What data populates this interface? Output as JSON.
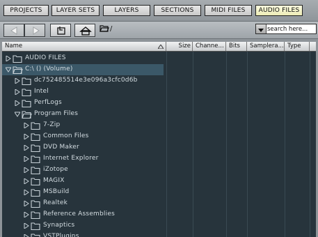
{
  "tabs": [
    {
      "label": "PROJECTS",
      "active": false
    },
    {
      "label": "LAYER SETS",
      "active": false
    },
    {
      "label": "LAYERS",
      "active": false
    },
    {
      "label": "SECTIONS",
      "active": false
    },
    {
      "label": "MIDI FILES",
      "active": false
    },
    {
      "label": "AUDIO FILES",
      "active": true
    }
  ],
  "nav": {
    "back_icon": "back-arrow-icon",
    "forward_icon": "forward-arrow-icon",
    "up_icon": "folder-up-icon",
    "home_icon": "home-icon",
    "path": "/"
  },
  "search": {
    "placeholder": "search here..."
  },
  "columns": [
    {
      "label": "Name",
      "sorted": true
    },
    {
      "label": "Size"
    },
    {
      "label": "Channe..."
    },
    {
      "label": "Bits"
    },
    {
      "label": "Samplera..."
    },
    {
      "label": "Type"
    }
  ],
  "tree": [
    {
      "name": "AUDIO FILES",
      "depth": 0,
      "expanded": false,
      "open_folder": false
    },
    {
      "name": "C:\\ () (Volume)",
      "depth": 0,
      "expanded": true,
      "open_folder": true
    },
    {
      "name": "dc752485514e3e096a3cfc0d6b",
      "depth": 1,
      "expanded": false,
      "open_folder": false
    },
    {
      "name": "Intel",
      "depth": 1,
      "expanded": false,
      "open_folder": false
    },
    {
      "name": "PerfLogs",
      "depth": 1,
      "expanded": false,
      "open_folder": false
    },
    {
      "name": "Program Files",
      "depth": 1,
      "expanded": true,
      "open_folder": true
    },
    {
      "name": "7-Zip",
      "depth": 2,
      "expanded": false,
      "open_folder": false
    },
    {
      "name": "Common Files",
      "depth": 2,
      "expanded": false,
      "open_folder": false
    },
    {
      "name": "DVD Maker",
      "depth": 2,
      "expanded": false,
      "open_folder": false
    },
    {
      "name": "Internet Explorer",
      "depth": 2,
      "expanded": false,
      "open_folder": false
    },
    {
      "name": "iZotope",
      "depth": 2,
      "expanded": false,
      "open_folder": false
    },
    {
      "name": "MAGIX",
      "depth": 2,
      "expanded": false,
      "open_folder": false
    },
    {
      "name": "MSBuild",
      "depth": 2,
      "expanded": false,
      "open_folder": false
    },
    {
      "name": "Realtek",
      "depth": 2,
      "expanded": false,
      "open_folder": false
    },
    {
      "name": "Reference Assemblies",
      "depth": 2,
      "expanded": false,
      "open_folder": false
    },
    {
      "name": "Synaptics",
      "depth": 2,
      "expanded": false,
      "open_folder": false
    },
    {
      "name": "VSTPlugins",
      "depth": 2,
      "expanded": false,
      "open_folder": false
    }
  ],
  "colors": {
    "active_tab": "#f4f3c8",
    "grid_background": "#27343c",
    "selected_row": "#3b5868",
    "tree_text": "#d4dde2"
  }
}
